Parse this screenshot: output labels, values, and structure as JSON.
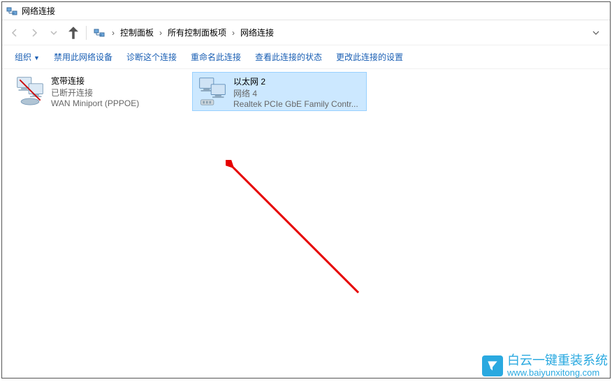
{
  "window": {
    "title": "网络连接"
  },
  "breadcrumb": {
    "items": [
      "控制面板",
      "所有控制面板项",
      "网络连接"
    ]
  },
  "toolbar": {
    "organize": "组织",
    "disable": "禁用此网络设备",
    "diagnose": "诊断这个连接",
    "rename": "重命名此连接",
    "status": "查看此连接的状态",
    "change": "更改此连接的设置"
  },
  "connections": [
    {
      "name": "宽带连接",
      "status": "已断开连接",
      "device": "WAN Miniport (PPPOE)",
      "selected": false
    },
    {
      "name": "以太网 2",
      "status": "网络 4",
      "device": "Realtek PCIe GbE Family Contr...",
      "selected": true
    }
  ],
  "watermark": {
    "text": "白云一键重装系统",
    "url": "www.baiyunxitong.com"
  }
}
